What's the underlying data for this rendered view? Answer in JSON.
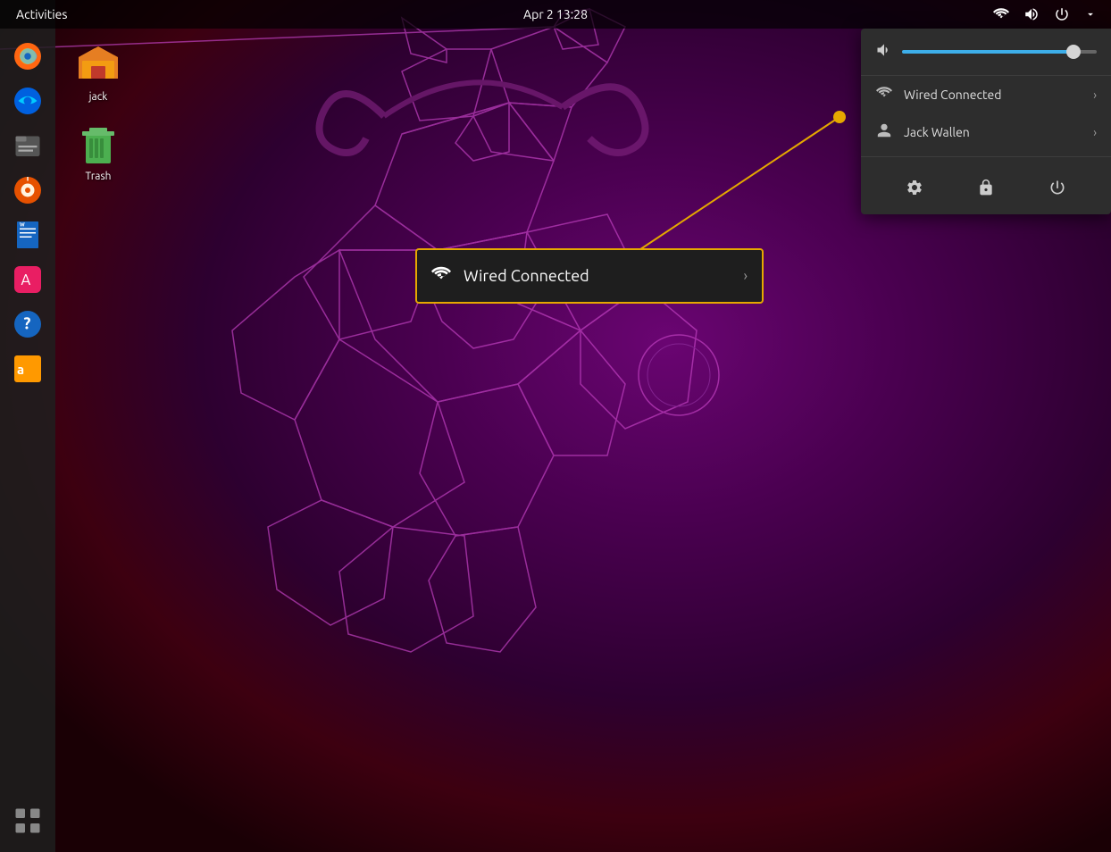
{
  "topbar": {
    "activities_label": "Activities",
    "clock": "Apr 2  13:28",
    "icons": [
      "network-icon",
      "volume-topbar-icon",
      "power-icon",
      "arrow-down-icon"
    ]
  },
  "dock": {
    "items": [
      {
        "name": "firefox",
        "label": "Firefox"
      },
      {
        "name": "thunderbird",
        "label": "Thunderbird"
      },
      {
        "name": "files",
        "label": "Files"
      },
      {
        "name": "rhythmbox",
        "label": "Rhythmbox"
      },
      {
        "name": "libreoffice-writer",
        "label": "LibreOffice Writer"
      },
      {
        "name": "software-center",
        "label": "Software Center"
      },
      {
        "name": "help",
        "label": "Help"
      },
      {
        "name": "amazon",
        "label": "Amazon"
      }
    ],
    "apps_grid_label": "Show Applications"
  },
  "desktop_icons": [
    {
      "name": "jack-home",
      "label": "jack",
      "type": "home"
    },
    {
      "name": "trash",
      "label": "Trash",
      "type": "trash"
    }
  ],
  "system_menu": {
    "volume_level": 88,
    "network_item_label": "Wired Connected",
    "user_item_label": "Jack Wallen",
    "actions": [
      {
        "name": "settings",
        "symbol": "⚙"
      },
      {
        "name": "lock",
        "symbol": "🔒"
      },
      {
        "name": "power",
        "symbol": "⏻"
      }
    ]
  },
  "wired_tooltip": {
    "label": "Wired Connected",
    "has_arrow": true
  }
}
